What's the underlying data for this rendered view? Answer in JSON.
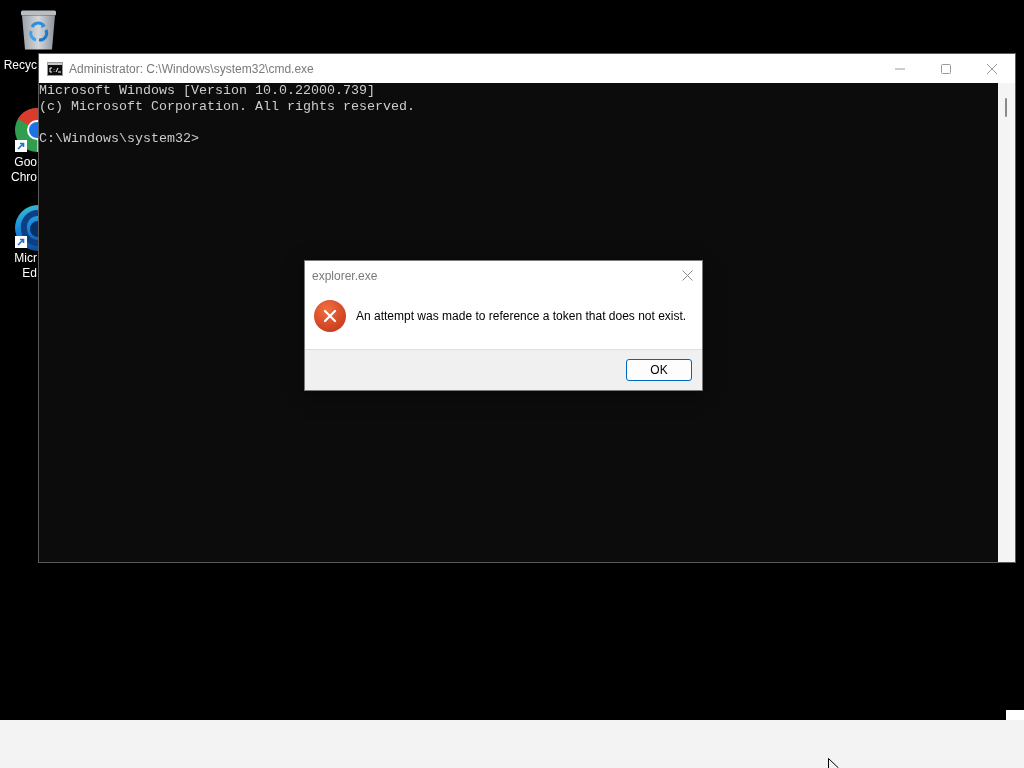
{
  "desktop": {
    "icons": [
      {
        "kind": "bin",
        "shortcut": false,
        "label_lines": [
          "Recyc"
        ]
      },
      {
        "kind": "chrome",
        "shortcut": true,
        "label_lines": [
          "Goo",
          "Chro"
        ]
      },
      {
        "kind": "edge",
        "shortcut": true,
        "label_lines": [
          "Micr",
          "Ed"
        ]
      }
    ]
  },
  "console_window": {
    "title": "Administrator: C:\\Windows\\system32\\cmd.exe",
    "output_blocks": [
      [
        "Microsoft Windows [Version 10.0.22000.739]",
        "(c) Microsoft Corporation. All rights reserved."
      ],
      [
        "C:\\Windows\\system32>"
      ]
    ]
  },
  "dialog": {
    "title": "explorer.exe",
    "kind": "error",
    "message": "An attempt was made to reference a token that does not exist.",
    "buttons": [
      {
        "label": "OK",
        "default": true
      }
    ]
  }
}
